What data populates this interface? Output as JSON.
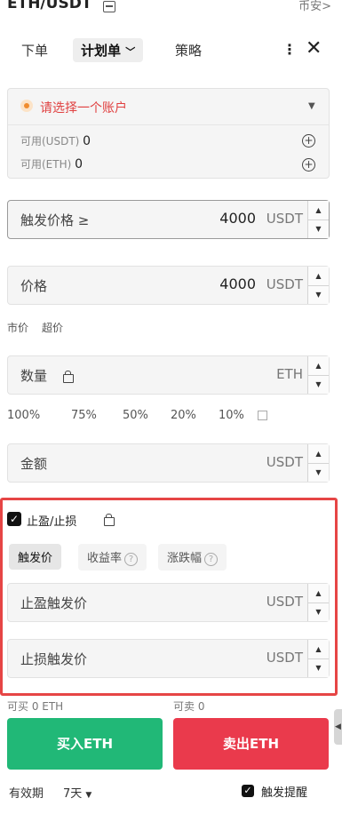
{
  "header": {
    "pair": "ETH/USDT",
    "exchange": "币安>"
  },
  "tabs": {
    "order": "下单",
    "plan": "计划单",
    "strategy": "策略"
  },
  "account": {
    "placeholder": "请选择一个账户",
    "avail_usdt_label": "可用(USDT)",
    "avail_usdt_value": "0",
    "avail_eth_label": "可用(ETH)",
    "avail_eth_value": "0"
  },
  "trigger": {
    "label": "触发价格 ≥",
    "value": "4000",
    "unit": "USDT"
  },
  "price": {
    "label": "价格",
    "value": "4000",
    "unit": "USDT"
  },
  "price_modes": {
    "market": "市价",
    "super": "超价"
  },
  "quantity": {
    "label": "数量",
    "unit": "ETH"
  },
  "percents": [
    "100%",
    "75%",
    "50%",
    "20%",
    "10%"
  ],
  "amount": {
    "label": "金额",
    "unit": "USDT"
  },
  "tpsl": {
    "label": "止盈/止损",
    "seg_trigger": "触发价",
    "seg_yield": "收益率",
    "seg_change": "涨跌幅",
    "tp_label": "止盈触发价",
    "tp_unit": "USDT",
    "sl_label": "止损触发价",
    "sl_unit": "USDT"
  },
  "balances": {
    "buyable": "可买 0 ETH",
    "sellable": "可卖 0"
  },
  "actions": {
    "buy": "买入ETH",
    "sell": "卖出ETH"
  },
  "footer": {
    "validity_label": "有效期",
    "validity_value": "7天",
    "trigger_alert": "触发提醒"
  },
  "colors": {
    "buy": "#21b877",
    "sell": "#ea3a4c",
    "highlight": "#e64545",
    "warning": "#e04040"
  }
}
